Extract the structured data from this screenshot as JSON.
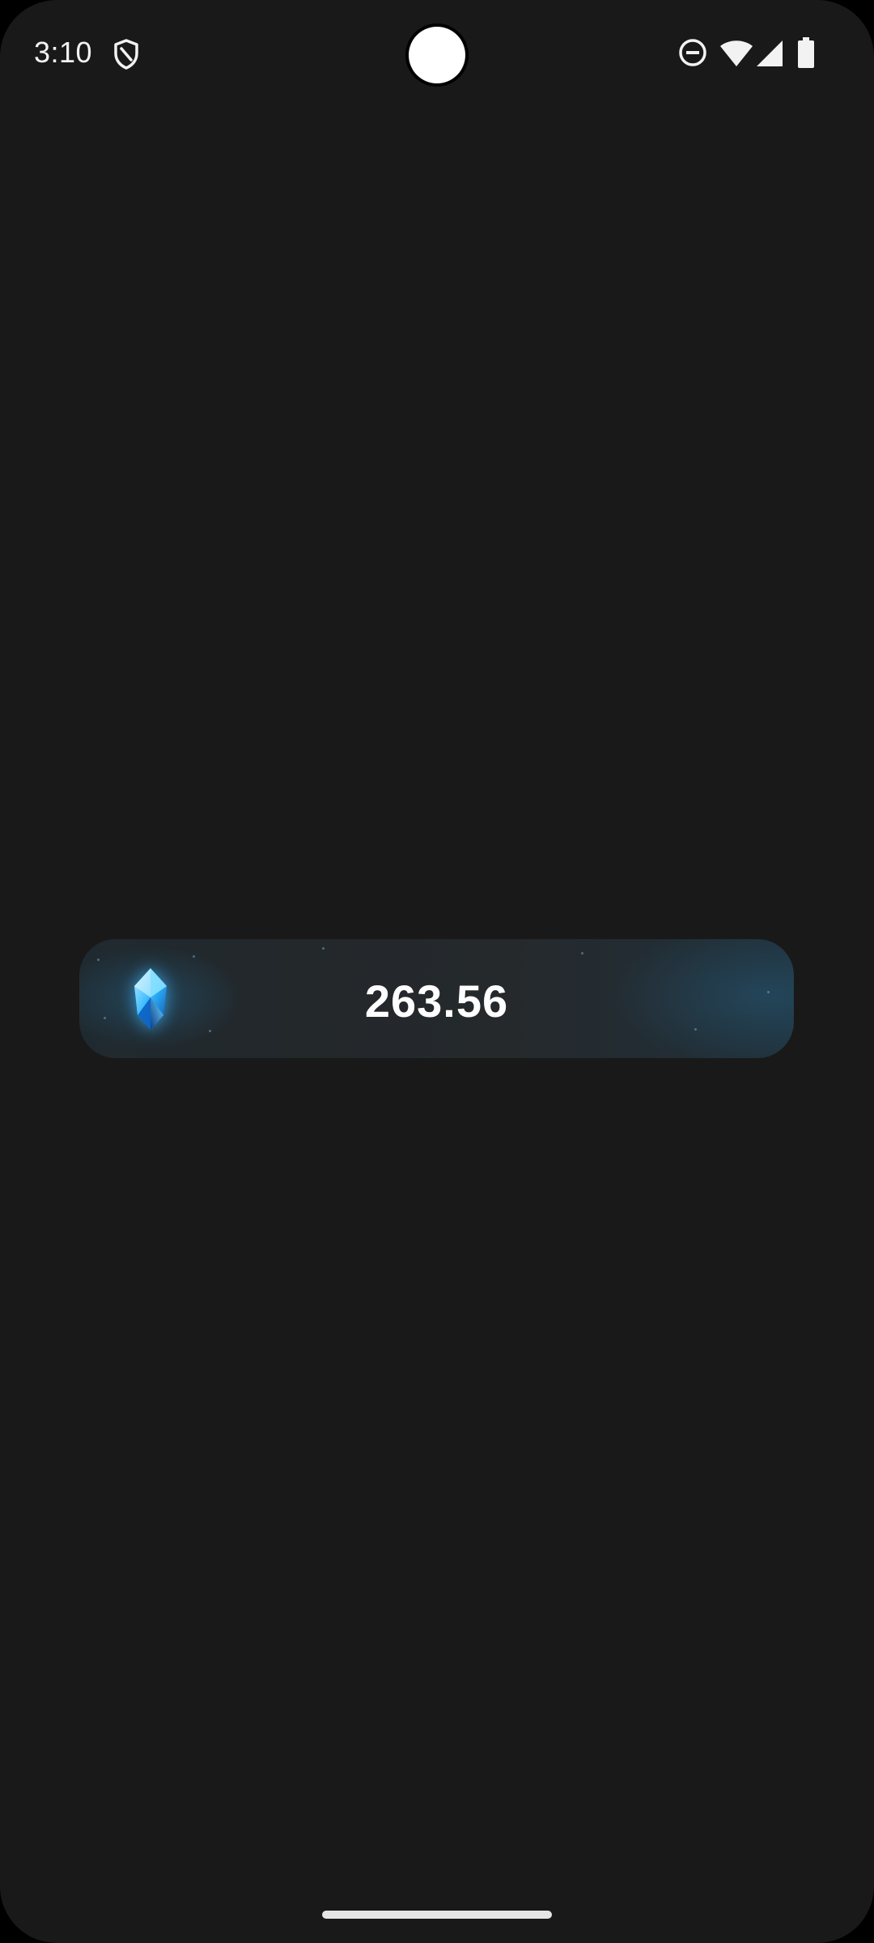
{
  "status_bar": {
    "time": "3:10",
    "icons": [
      "shield-icon",
      "do-not-disturb-icon",
      "wifi-icon",
      "signal-icon",
      "battery-icon"
    ]
  },
  "balance": {
    "icon": "gem-icon",
    "value": "263.56",
    "accent_color": "#2fb6ff"
  },
  "colors": {
    "background": "#191919",
    "pill_background": "#23282b",
    "text": "#ffffff"
  }
}
